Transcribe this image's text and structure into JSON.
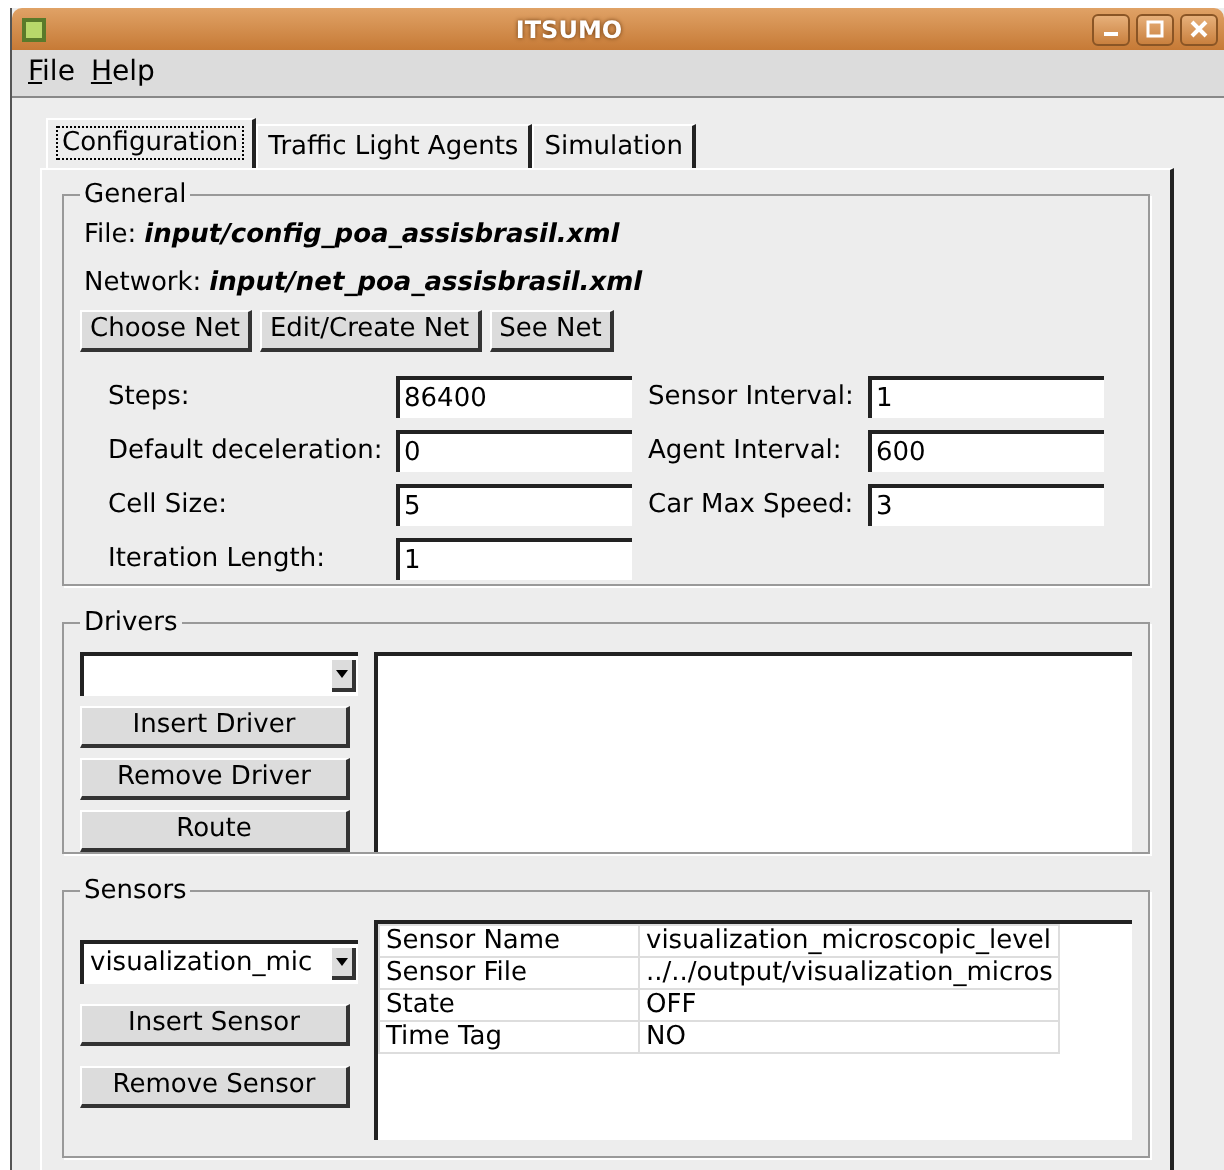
{
  "window": {
    "title": "ITSUMO"
  },
  "menu": [
    "File",
    "Help"
  ],
  "tabs": [
    {
      "label": "Configuration",
      "selected": true
    },
    {
      "label": "Traffic Light Agents",
      "selected": false
    },
    {
      "label": "Simulation",
      "selected": false
    }
  ],
  "general": {
    "legend": "General",
    "file": {
      "label": "File:",
      "value": "input/config_poa_assisbrasil.xml"
    },
    "network": {
      "label": "Network:",
      "value": "input/net_poa_assisbrasil.xml"
    },
    "buttons": [
      "Choose Net",
      "Edit/Create Net",
      "See Net"
    ],
    "fields": [
      {
        "label": "Steps:",
        "value": "86400"
      },
      {
        "label": "Sensor Interval:",
        "value": "1"
      },
      {
        "label": "Default deceleration:",
        "value": "0"
      },
      {
        "label": "Agent Interval:",
        "value": "600"
      },
      {
        "label": "Cell Size:",
        "value": "5"
      },
      {
        "label": "Car Max Speed:",
        "value": "3"
      },
      {
        "label": "Iteration Length:",
        "value": "1"
      }
    ]
  },
  "drivers": {
    "legend": "Drivers",
    "buttons": [
      "Insert Driver",
      "Remove Driver",
      "Route"
    ]
  },
  "sensors": {
    "legend": "Sensors",
    "dropdown": "visualization_mic",
    "buttons": [
      "Insert Sensor",
      "Remove Sensor"
    ],
    "rows": [
      [
        "Sensor Name",
        "visualization_microscopic_level"
      ],
      [
        "Sensor File",
        "../../output/visualization_micros"
      ],
      [
        "State",
        "OFF"
      ],
      [
        "Time Tag",
        "NO"
      ]
    ]
  }
}
